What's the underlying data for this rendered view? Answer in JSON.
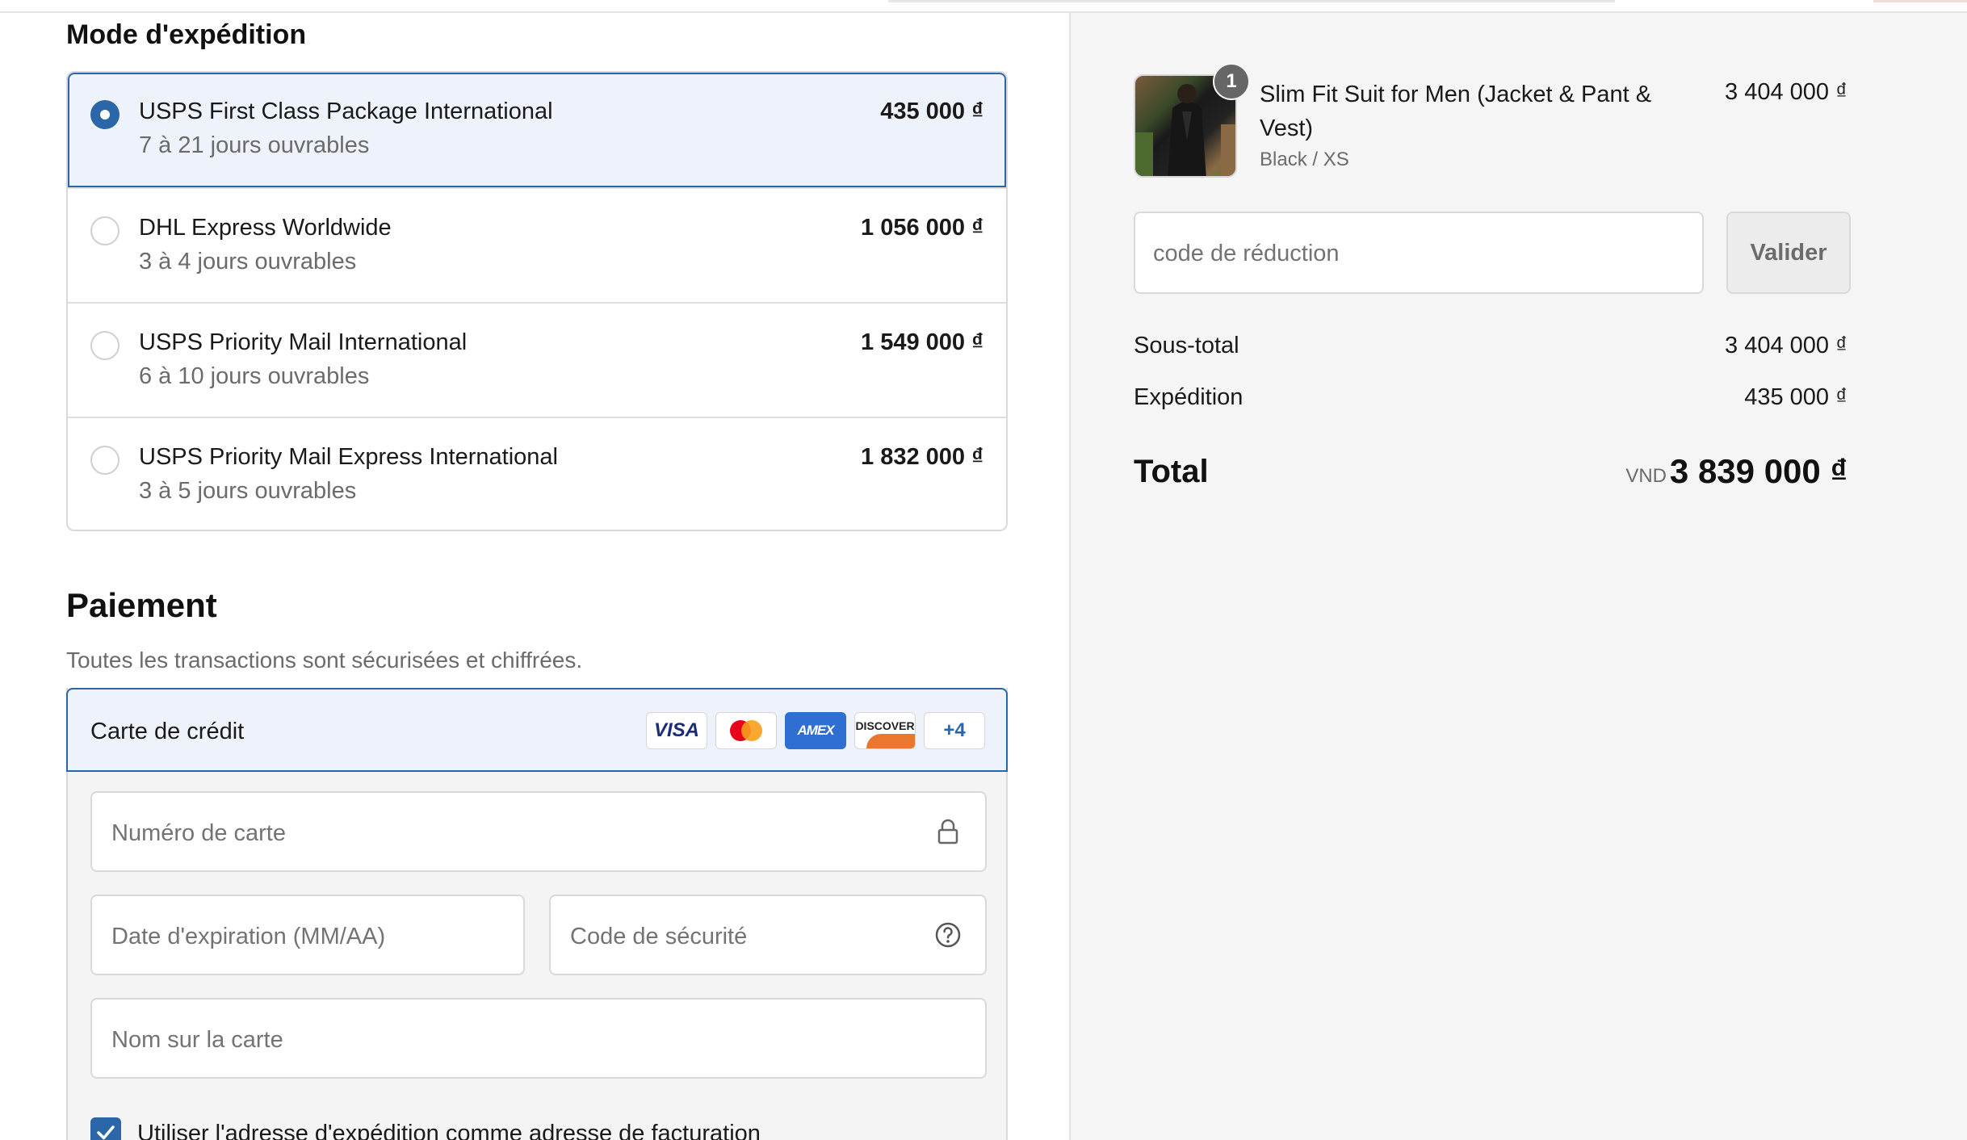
{
  "shipping": {
    "title": "Mode d'expédition",
    "options": [
      {
        "name": "USPS First Class Package International",
        "eta": "7 à 21 jours ouvrables",
        "price": "435 000 ₫",
        "selected": true
      },
      {
        "name": "DHL Express Worldwide",
        "eta": "3 à 4 jours ouvrables",
        "price": "1 056 000 ₫",
        "selected": false
      },
      {
        "name": "USPS Priority Mail International",
        "eta": "6 à 10 jours ouvrables",
        "price": "1 549 000 ₫",
        "selected": false
      },
      {
        "name": "USPS Priority Mail Express International",
        "eta": "3 à 5 jours ouvrables",
        "price": "1 832 000 ₫",
        "selected": false
      }
    ]
  },
  "payment": {
    "title": "Paiement",
    "subtitle": "Toutes les transactions sont sécurisées et chiffrées.",
    "method_label": "Carte de crédit",
    "brands": [
      "VISA",
      "Mastercard",
      "AMEX",
      "DISCOVER",
      "+4"
    ],
    "card_number_placeholder": "Numéro de carte",
    "expiry_placeholder": "Date d'expiration (MM/AA)",
    "security_code_placeholder": "Code de sécurité",
    "name_placeholder": "Nom sur la carte",
    "billing_checkbox_label": "Utiliser l'adresse d'expédition comme adresse de facturation",
    "billing_checked": true
  },
  "summary": {
    "product": {
      "quantity": "1",
      "name": "Slim Fit Suit for Men (Jacket & Pant & Vest)",
      "variant": "Black / XS",
      "price": "3 404 000 ₫"
    },
    "discount_placeholder": "code de réduction",
    "apply_label": "Valider",
    "subtotal_label": "Sous-total",
    "subtotal_value": "3 404 000 ₫",
    "shipping_label": "Expédition",
    "shipping_value": "435 000 ₫",
    "total_label": "Total",
    "currency": "VND",
    "total_value": "3 839 000 ₫"
  },
  "colors": {
    "accent": "#2b66a8",
    "selected_bg": "#eef3fb",
    "summary_bg": "#f5f5f5"
  },
  "icons": [
    "lock-icon",
    "question-circle-icon",
    "check-icon"
  ]
}
